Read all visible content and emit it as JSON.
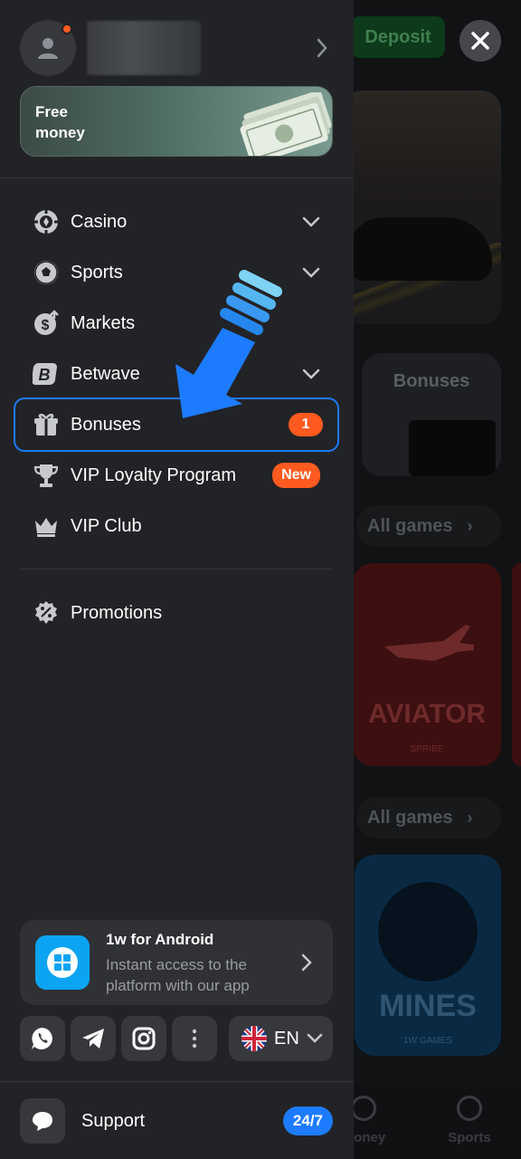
{
  "background": {
    "deposit_label": "Deposit",
    "bonuses_tile_label": "Bonuses",
    "all_games_label": "All games",
    "aviator": {
      "title": "AVIATOR",
      "provider": "SPRIBE"
    },
    "mines": {
      "title": "MINES",
      "provider": "1W GAMES"
    },
    "bottom_nav": [
      "money",
      "Sports"
    ]
  },
  "drawer": {
    "free_money_label": "Free\nmoney",
    "menu": [
      {
        "label": "Casino",
        "icon": "poker-chip-icon",
        "has_chevron": true
      },
      {
        "label": "Sports",
        "icon": "soccer-ball-icon",
        "has_chevron": true
      },
      {
        "label": "Markets",
        "icon": "dollar-trend-icon",
        "has_chevron": false
      },
      {
        "label": "Betwave",
        "icon": "betwave-b-icon",
        "has_chevron": true
      },
      {
        "label": "Bonuses",
        "icon": "gift-icon",
        "badge": "1",
        "active": true
      },
      {
        "label": "VIP Loyalty Program",
        "icon": "trophy-icon",
        "badge": "New"
      },
      {
        "label": "VIP Club",
        "icon": "crown-icon"
      }
    ],
    "promotions_label": "Promotions",
    "app_promo": {
      "title": "1w for Android",
      "subtitle": "Instant access to the platform with our app"
    },
    "socials": [
      "whatsapp-icon",
      "telegram-icon",
      "instagram-icon",
      "more-icon"
    ],
    "language": {
      "code": "EN"
    },
    "support": {
      "label": "Support",
      "badge": "24/7"
    }
  },
  "colors": {
    "drawer_bg": "#222326",
    "accent_blue": "#1d7bff",
    "badge_orange": "#ff5a1f",
    "android_app_blue": "#0ca4f2"
  }
}
